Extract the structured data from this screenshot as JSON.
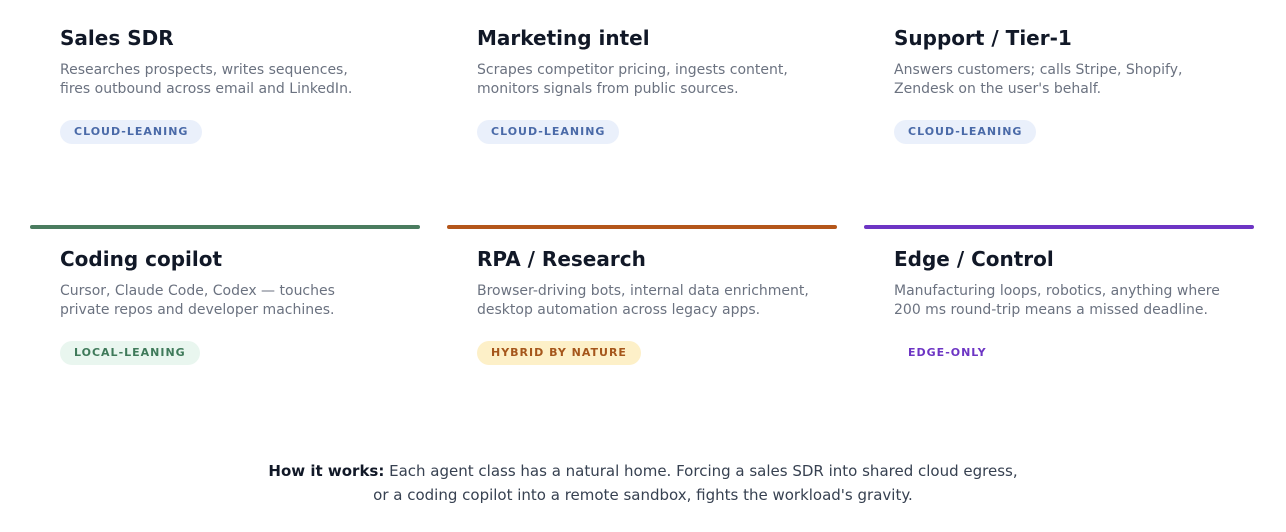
{
  "cards": [
    {
      "title": "Sales SDR",
      "desc_lines": [
        "Researches prospects, writes sequences,",
        "fires outbound across email and LinkedIn."
      ],
      "badge": "CLOUD-LEANING"
    },
    {
      "title": "Marketing intel",
      "desc_lines": [
        "Scrapes competitor pricing, ingests content,",
        "monitors signals from public sources."
      ],
      "badge": "CLOUD-LEANING"
    },
    {
      "title": "Support / Tier-1",
      "desc_lines": [
        "Answers customers; calls Stripe, Shopify,",
        "Zendesk on the user's behalf."
      ],
      "badge": "CLOUD-LEANING"
    },
    {
      "title": "Coding copilot",
      "desc_lines": [
        "Cursor, Claude Code, Codex — touches",
        "private repos and developer machines."
      ],
      "badge": "LOCAL-LEANING",
      "accent": "#4a7c5f"
    },
    {
      "title": "RPA / Research",
      "desc_lines": [
        "Browser-driving bots, internal data enrichment,",
        "desktop automation across legacy apps."
      ],
      "badge": "HYBRID BY NATURE",
      "accent": "#b4561a"
    },
    {
      "title": "Edge / Control",
      "desc_lines": [
        "Manufacturing loops, robotics, anything where",
        "200 ms round-trip means a missed deadline."
      ],
      "badge": "EDGE-ONLY",
      "accent": "#6d35c4"
    }
  ],
  "footer": {
    "lead": "How it works:",
    "line1": " Each agent class has a natural home. Forcing a sales SDR into shared cloud egress,",
    "line2": "or a coding copilot into a remote sandbox, fights the workload's gravity."
  }
}
